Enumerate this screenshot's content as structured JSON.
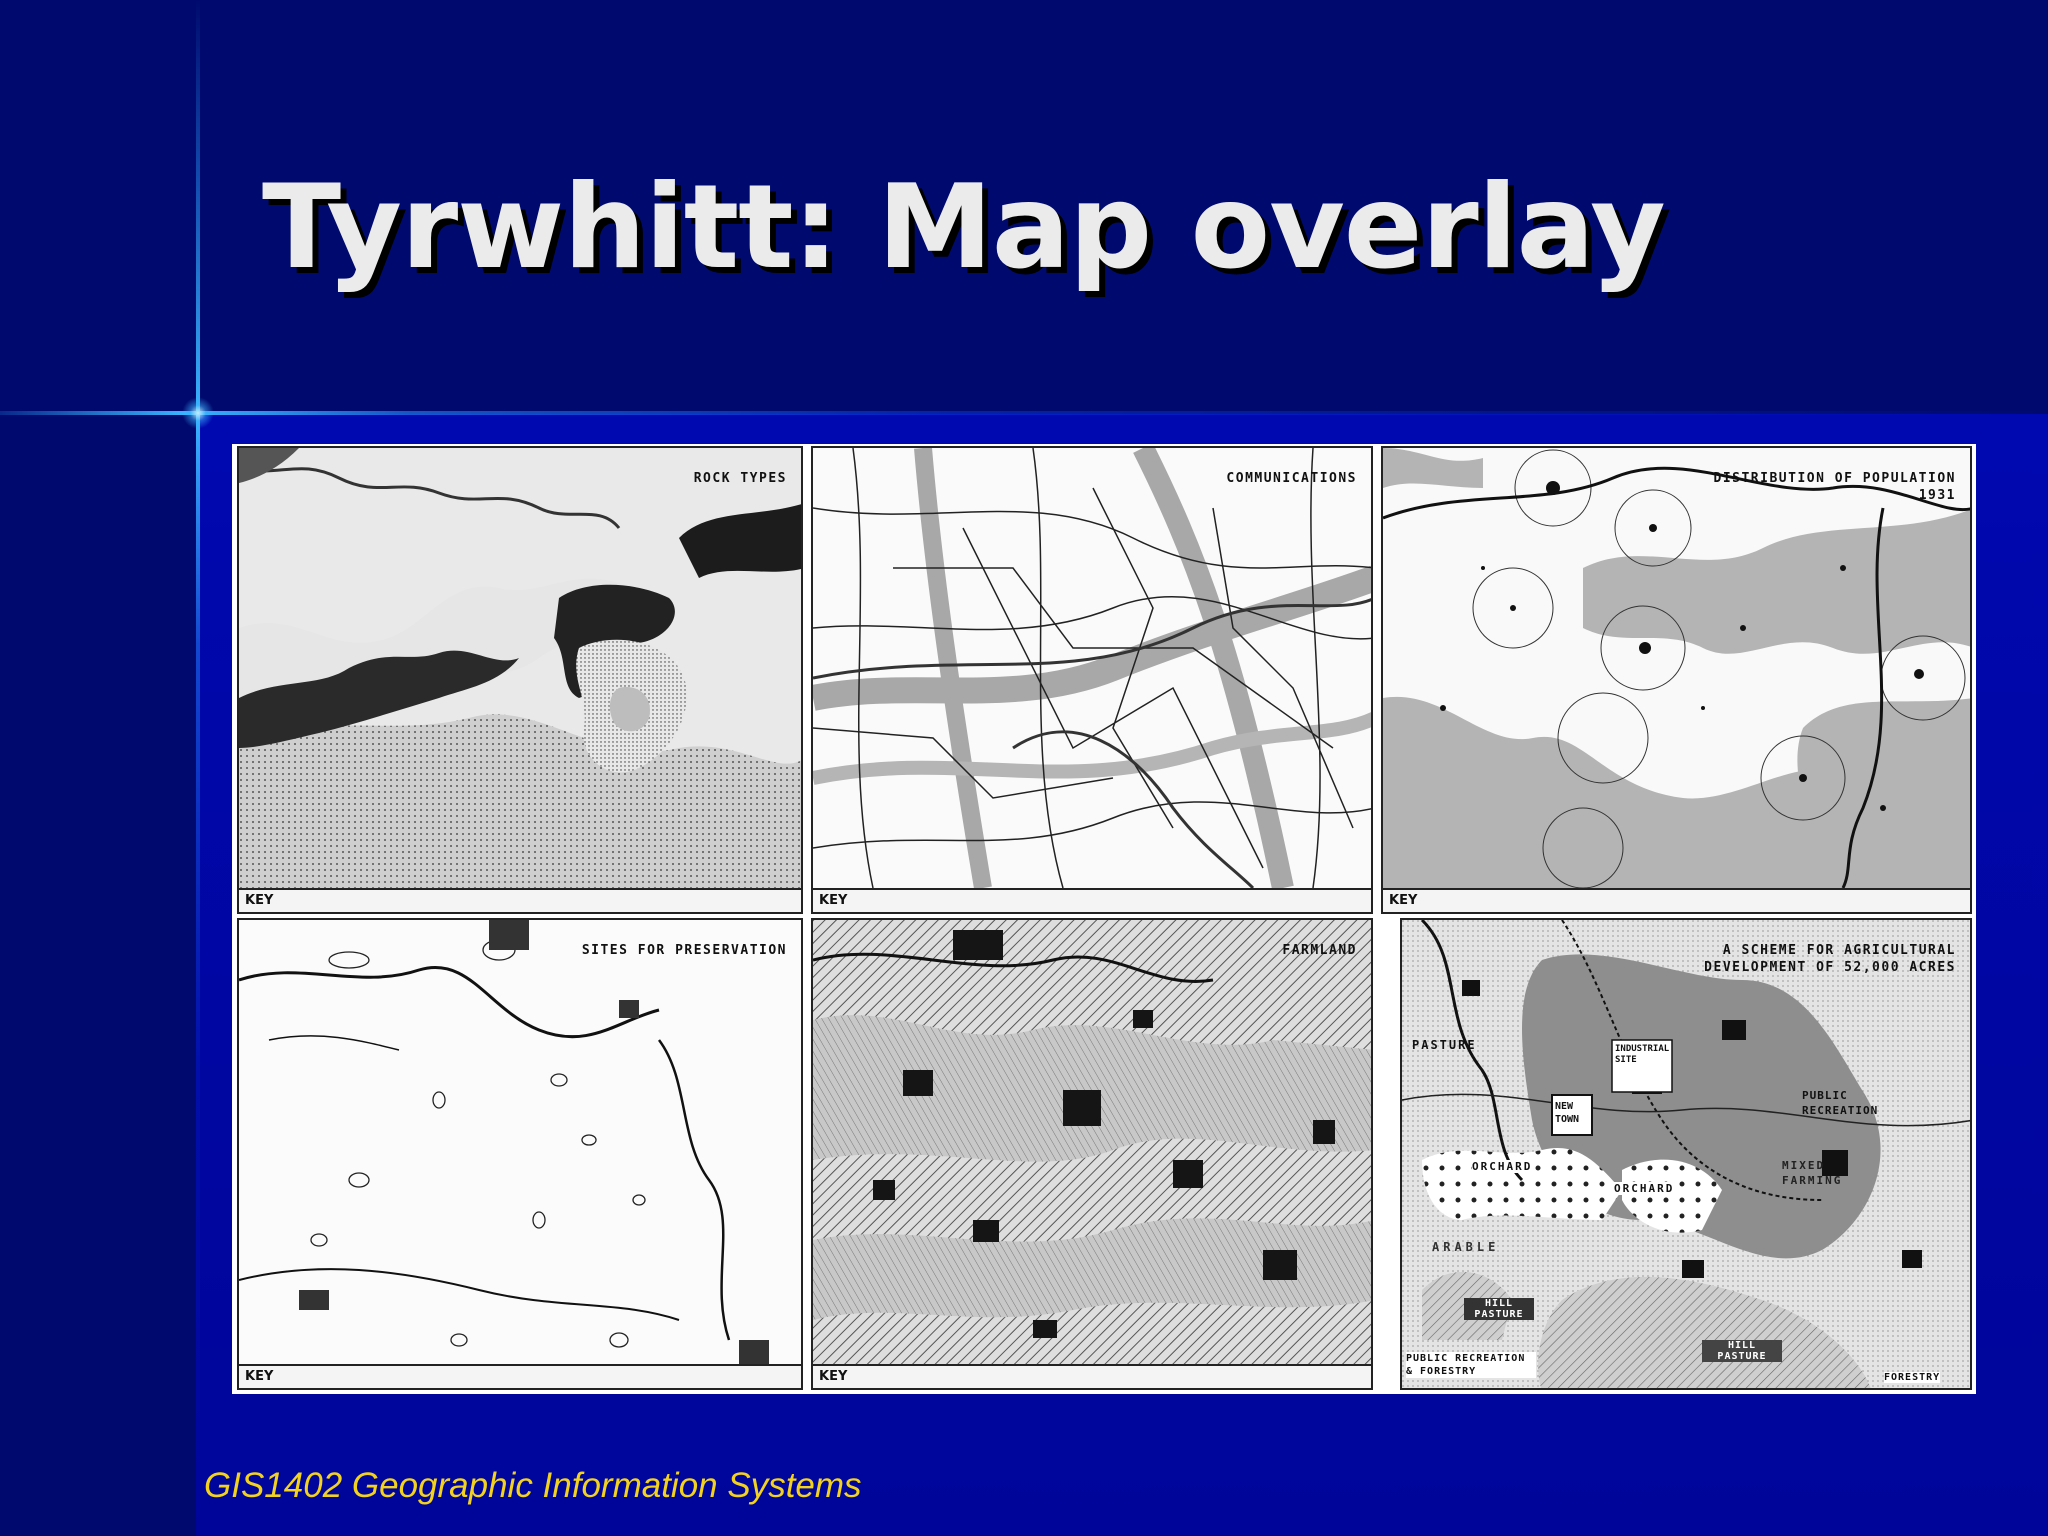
{
  "slide": {
    "title": "Tyrwhitt: Map overlay",
    "footer": "GIS1402 Geographic Information Systems"
  },
  "figure": {
    "panels": [
      {
        "title": "ROCK TYPES",
        "key": "KEY"
      },
      {
        "title": "COMMUNICATIONS",
        "key": "KEY"
      },
      {
        "title": "DISTRIBUTION OF POPULATION",
        "subtitle": "1931",
        "key": "KEY"
      },
      {
        "title": "SITES FOR PRESERVATION",
        "key": "KEY"
      },
      {
        "title": "FARMLAND",
        "key": "KEY"
      },
      {
        "title": "A SCHEME FOR AGRICULTURAL",
        "subtitle": "DEVELOPMENT OF 52,000 ACRES"
      }
    ],
    "scheme_labels": {
      "pasture": "PASTURE",
      "public_recreation": "PUBLIC RECREATION",
      "mixed_farming": "MIXED FARMING",
      "orchard_left": "ORCHARD",
      "orchard_right": "ORCHARD",
      "new_town": "NEW TOWN",
      "arable": "ARABLE",
      "hill_pasture_left": "HILL PASTURE",
      "hill_pasture_right": "HILL PASTURE",
      "public_recreation_forestry": "PUBLIC RECREATION & FORESTRY",
      "forestry": "FORESTRY",
      "industrial_site": "INDUSTRIAL SITE"
    }
  }
}
